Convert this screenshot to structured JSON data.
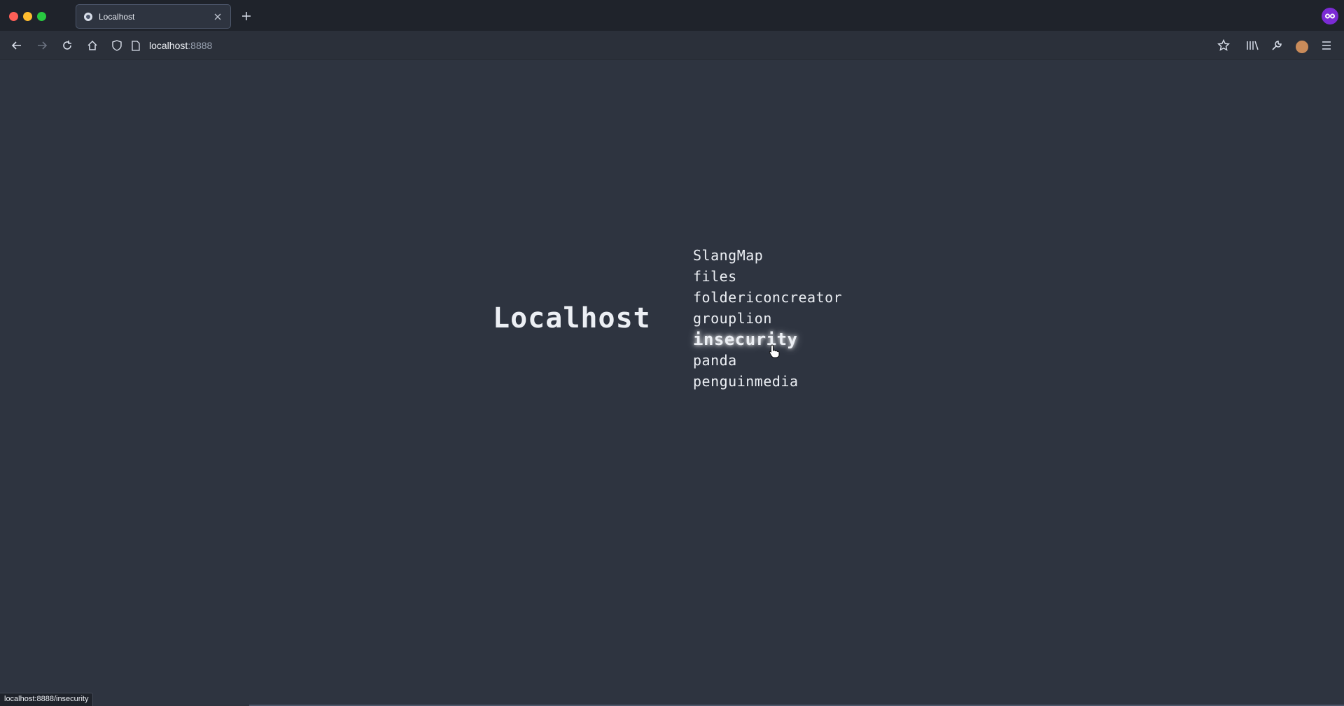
{
  "browser": {
    "tab": {
      "title": "Localhost"
    },
    "url": {
      "host": "localhost",
      "port": ":8888"
    },
    "status_url": "localhost:8888/insecurity"
  },
  "page": {
    "title": "Localhost",
    "links": [
      {
        "label": "SlangMap",
        "hovered": false
      },
      {
        "label": "files",
        "hovered": false
      },
      {
        "label": "foldericoncreator",
        "hovered": false
      },
      {
        "label": "grouplion",
        "hovered": false
      },
      {
        "label": "insecurity",
        "hovered": true
      },
      {
        "label": "panda",
        "hovered": false
      },
      {
        "label": "penguinmedia",
        "hovered": false
      }
    ]
  },
  "icons": {
    "nav": [
      "back-arrow-icon",
      "forward-arrow-icon",
      "reload-icon",
      "home-icon",
      "shield-icon",
      "page-icon"
    ],
    "right": [
      "bookmark-star-icon",
      "library-icon",
      "wrench-icon",
      "profile-avatar-icon",
      "hamburger-menu-icon"
    ]
  },
  "colors": {
    "page_bg": "#2e3440",
    "text": "#eceff4",
    "chrome_bg": "#1f232b"
  }
}
